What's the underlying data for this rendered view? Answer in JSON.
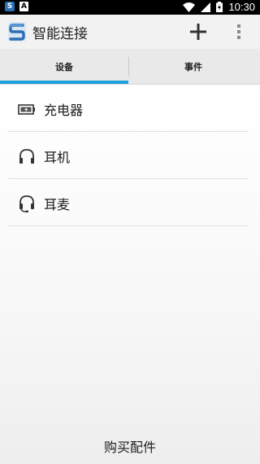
{
  "status_bar": {
    "app_badge": "S",
    "a_badge": "A",
    "time": "10:30"
  },
  "app_bar": {
    "title": "智能连接"
  },
  "tabs": [
    {
      "label": "设备"
    },
    {
      "label": "事件"
    }
  ],
  "devices": [
    {
      "label": "充电器",
      "icon": "charger-icon"
    },
    {
      "label": "耳机",
      "icon": "headphones-icon"
    },
    {
      "label": "耳麦",
      "icon": "headset-icon"
    }
  ],
  "footer": {
    "buy_label": "购买配件"
  },
  "colors": {
    "accent": "#1aa1de",
    "logo": "#2a6fb4"
  }
}
